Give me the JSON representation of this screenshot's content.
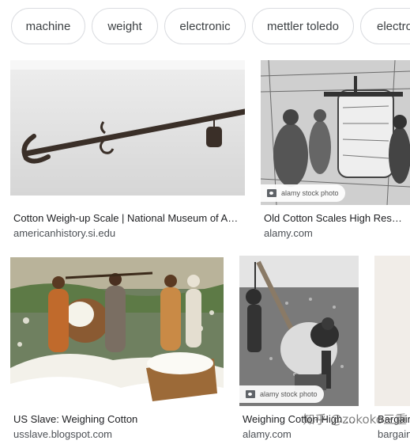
{
  "chips": [
    {
      "label": "machine"
    },
    {
      "label": "weight"
    },
    {
      "label": "electronic"
    },
    {
      "label": "mettler toledo"
    },
    {
      "label": "electro"
    }
  ],
  "results": [
    {
      "title": "Cotton Weigh-up Scale | National Museum of Amer…",
      "source": "americanhistory.si.edu",
      "badge": ""
    },
    {
      "title": "Old Cotton Scales High Resolu…",
      "source": "alamy.com",
      "badge": "alamy stock photo"
    },
    {
      "title": "US Slave: Weighing Cotton",
      "source": "usslave.blogspot.com",
      "badge": ""
    },
    {
      "title": "Weighing Cotton High R…",
      "source": "alamy.com",
      "badge": "alamy stock photo"
    },
    {
      "title": "Bargain…",
      "source": "bargain",
      "badge": ""
    }
  ],
  "watermark": "知乎 @zokoko三重",
  "icons": {
    "badge_icon": "image-icon"
  }
}
